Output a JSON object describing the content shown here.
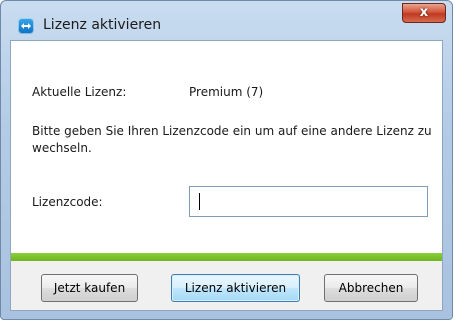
{
  "window": {
    "title": "Lizenz aktivieren",
    "close_symbol": "x"
  },
  "license": {
    "label": "Aktuelle Lizenz:",
    "value": "Premium (7)"
  },
  "info_text": "Bitte geben Sie Ihren Lizenzcode ein um auf eine andere Lizenz zu wechseln.",
  "code": {
    "label": "Lizenzcode:",
    "value": ""
  },
  "buttons": {
    "buy": "Jetzt kaufen",
    "activate": "Lizenz aktivieren",
    "cancel": "Abbrechen"
  },
  "icons": {
    "app": "teamviewer-icon",
    "close": "close-icon"
  },
  "colors": {
    "accent_bar": "#7cc52b",
    "close_button": "#c94a30"
  }
}
